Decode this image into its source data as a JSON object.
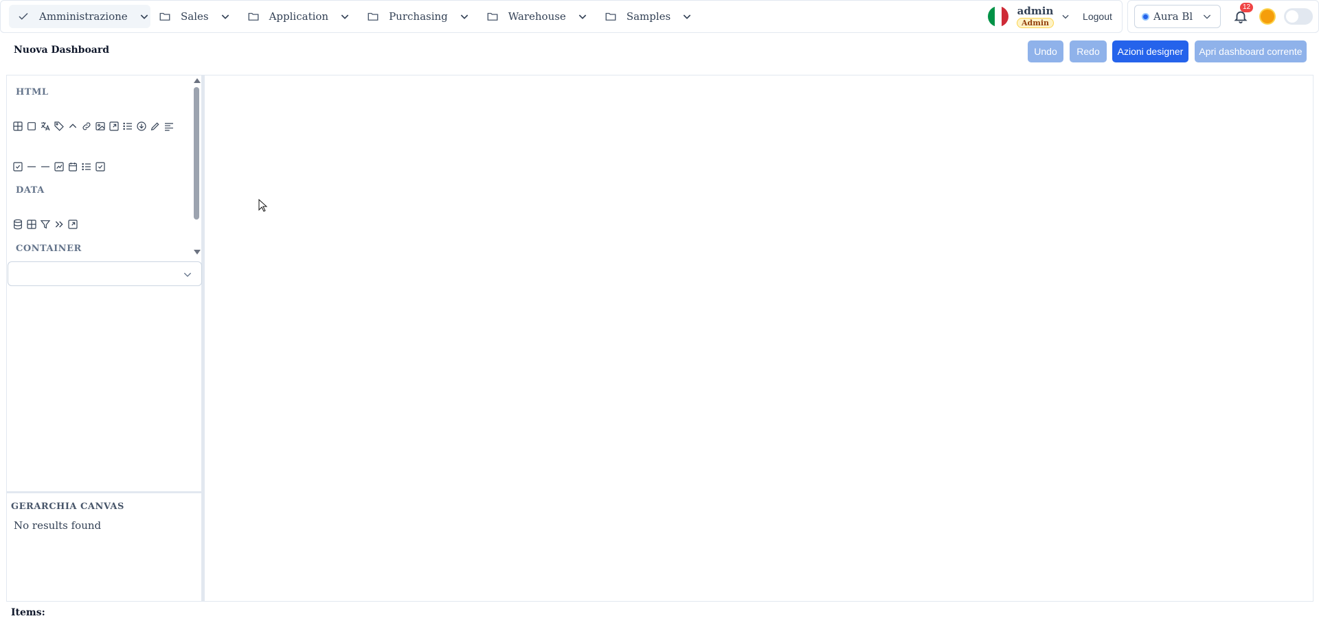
{
  "nav": {
    "items": [
      {
        "label": "Amministrazione",
        "icon": "check-icon",
        "active": true
      },
      {
        "label": "Sales",
        "icon": "folder-icon"
      },
      {
        "label": "Application",
        "icon": "folder-icon"
      },
      {
        "label": "Purchasing",
        "icon": "folder-icon"
      },
      {
        "label": "Warehouse",
        "icon": "folder-icon"
      },
      {
        "label": "Samples",
        "icon": "folder-icon"
      }
    ]
  },
  "user": {
    "language_flag": "italy-flag-icon",
    "name": "admin",
    "role": "Admin",
    "logout_label": "Logout"
  },
  "tools": {
    "theme_label": "Aura Bl",
    "theme_color": "#2563eb",
    "notification_count": "12"
  },
  "page": {
    "title": "Nuova Dashboard",
    "items_label": "Items:"
  },
  "toolbar": {
    "undo_label": "Undo",
    "redo_label": "Redo",
    "designer_actions_label": "Azioni designer",
    "open_dashboard_label": "Apri dashboard corrente"
  },
  "palette": {
    "html_title": "HTML",
    "html_row1": [
      "table-icon",
      "box-icon",
      "translate-icon",
      "tag-icon",
      "chevron-up-icon",
      "link-icon",
      "image-icon",
      "external-link-icon",
      "list-icon",
      "download-icon",
      "pencil-icon",
      "text-align-left-icon"
    ],
    "html_row2": [
      "checkbox-icon",
      "divider-icon",
      "divider-icon",
      "chart-line-icon",
      "calendar-icon",
      "list-icon",
      "checkbox-icon"
    ],
    "data_title": "DATA",
    "data_row": [
      "database-icon",
      "table-icon",
      "filter-icon",
      "chevrons-right-icon",
      "external-link-icon"
    ],
    "container_title": "CONTAINER"
  },
  "hierarchy": {
    "title": "GERARCHIA CANVAS",
    "empty_text": "No results found"
  },
  "colors": {
    "primary": "#2563eb",
    "primary_disabled": "#8fb2ea",
    "border": "#e2e8f0",
    "badge": "#ef4444"
  }
}
